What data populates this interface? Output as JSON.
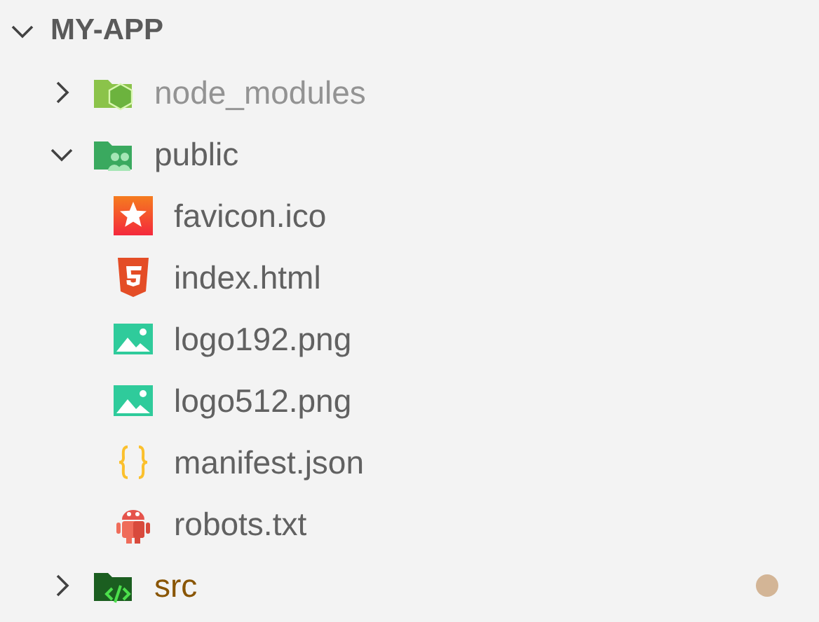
{
  "explorer": {
    "root": {
      "label": "MY-APP",
      "expanded": true,
      "children": [
        {
          "kind": "node-folder",
          "label": "node_modules",
          "expanded": false,
          "dimmed": true,
          "modified": false
        },
        {
          "kind": "public-folder",
          "label": "public",
          "expanded": true,
          "dimmed": false,
          "modified": false,
          "children": [
            {
              "kind": "favicon",
              "label": "favicon.ico",
              "dimmed": false,
              "modified": false
            },
            {
              "kind": "html",
              "label": "index.html",
              "dimmed": false,
              "modified": false
            },
            {
              "kind": "image",
              "label": "logo192.png",
              "dimmed": false,
              "modified": false
            },
            {
              "kind": "image",
              "label": "logo512.png",
              "dimmed": false,
              "modified": false
            },
            {
              "kind": "json",
              "label": "manifest.json",
              "dimmed": false,
              "modified": false
            },
            {
              "kind": "robots",
              "label": "robots.txt",
              "dimmed": false,
              "modified": false
            }
          ]
        },
        {
          "kind": "src-folder",
          "label": "src",
          "expanded": false,
          "dimmed": false,
          "modified": true
        }
      ]
    }
  }
}
